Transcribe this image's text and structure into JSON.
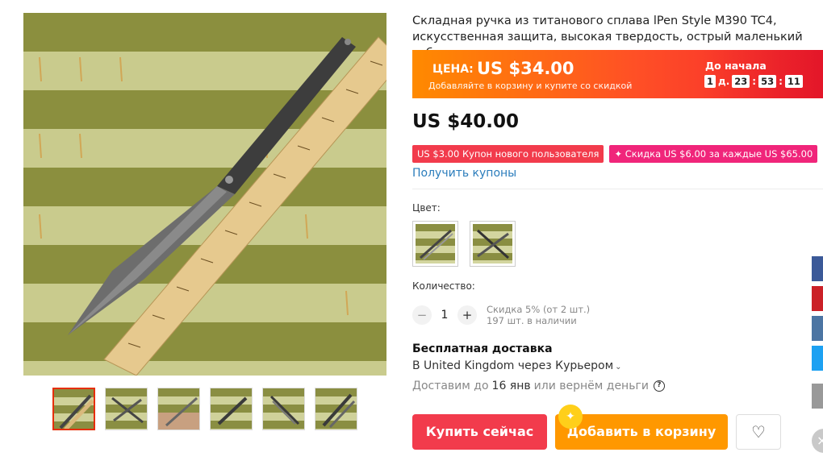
{
  "product": {
    "title": "Складная ручка из титанового сплава lPen Style M390 TC4, искусственная защита, высокая твердость, острый маленький сабель"
  },
  "promo": {
    "price_label": "ЦЕНА:",
    "price_value": "US $34.00",
    "subtitle": "Добавляйте в корзину и купите со скидкой",
    "start_label": "До начала",
    "countdown": {
      "days": "1",
      "days_unit": "д.",
      "hours": "23",
      "minutes": "53",
      "seconds": "11"
    }
  },
  "price_original": "US $40.00",
  "coupons": [
    {
      "label": "US $3.00 Купон нового пользователя"
    },
    {
      "label": "✦ Скидка US $6.00 за каждые US $65.00"
    }
  ],
  "get_coupons_label": "Получить купоны",
  "color": {
    "label": "Цвет:"
  },
  "quantity": {
    "label": "Количество:",
    "minus": "−",
    "value": "1",
    "plus": "+",
    "discount": "Скидка 5% (от 2 шт.)",
    "stock": "197 шт. в наличии"
  },
  "shipping": {
    "title": "Бесплатная доставка",
    "destination": "В United Kingdom через Курьером",
    "chevron": "⌄",
    "eta_prefix": "Доставим до",
    "eta_date": "16 янв",
    "eta_suffix": "или вернём деньги",
    "help": "?"
  },
  "actions": {
    "buy_now": "Купить сейчас",
    "add_to_cart": "Добавить в корзину",
    "cart_sparkle": "✦",
    "wishlist": "♡"
  },
  "colors": {
    "primary_red": "#f23b4c",
    "orange": "#ff9800",
    "link_blue": "#2b7dbc"
  }
}
